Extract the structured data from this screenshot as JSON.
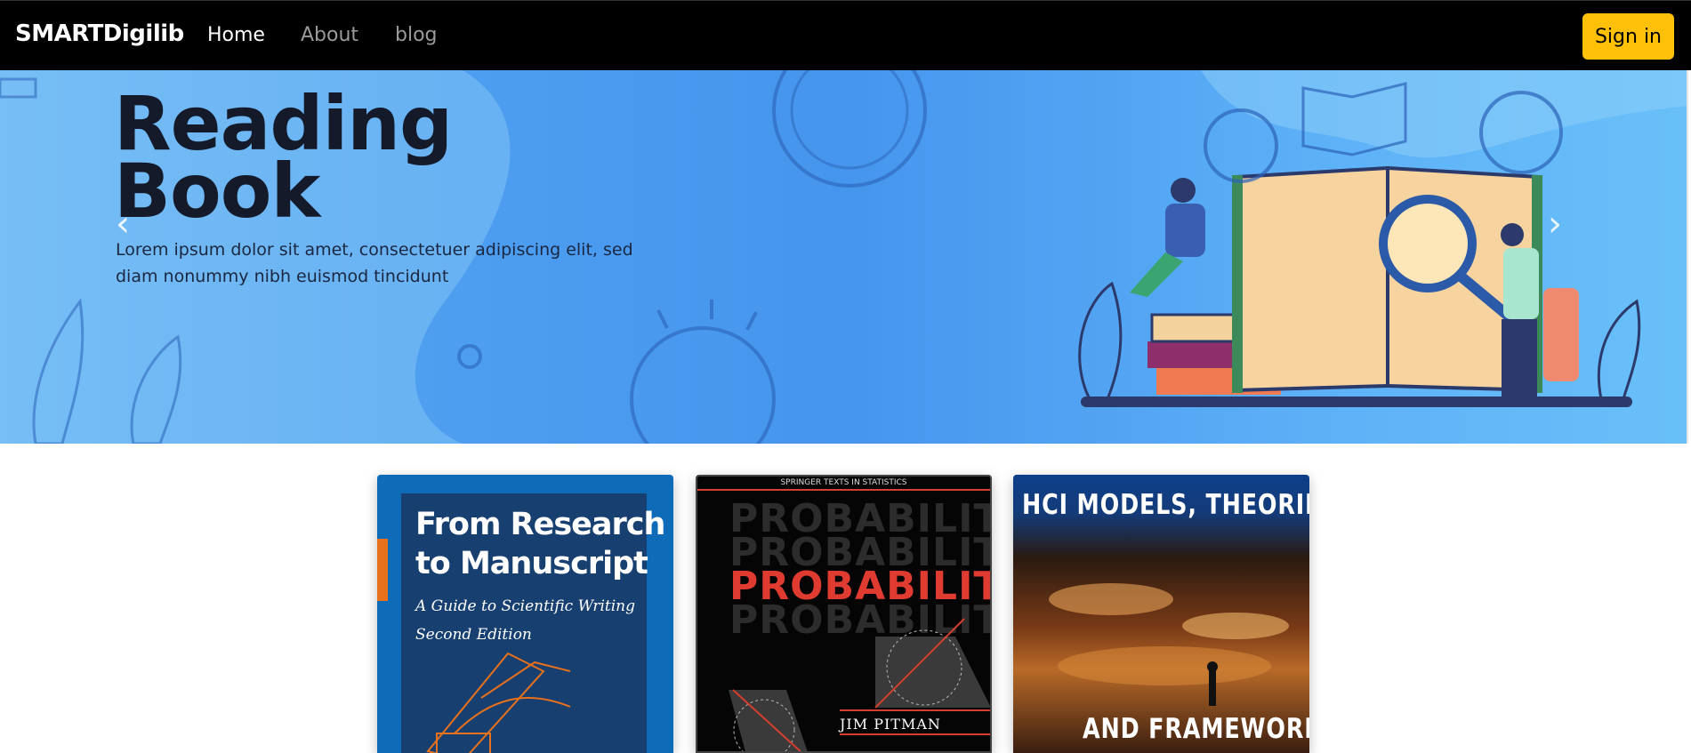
{
  "navbar": {
    "brand": "SMARTDigilib",
    "links": [
      {
        "label": "Home",
        "active": true
      },
      {
        "label": "About",
        "active": false
      },
      {
        "label": "blog",
        "active": false
      }
    ],
    "signin_label": "Sign in",
    "signin_color": "#ffc107"
  },
  "carousel": {
    "title_line1": "Reading",
    "title_line2": "Book",
    "subtitle_line1": "Lorem ipsum dolor sit amet, consectetuer adipiscing elit, sed",
    "subtitle_line2": "diam nonummy nibh euismod tincidunt",
    "prev_icon": "chevron-left-icon",
    "next_icon": "chevron-right-icon"
  },
  "books": [
    {
      "title_line1": "From Research",
      "title_line2": "to Manuscript",
      "subtitle_line1": "A Guide to Scientific Writing",
      "subtitle_line2": "Second Edition"
    },
    {
      "series": "SPRINGER TEXTS IN STATISTICS",
      "title": "PROBABILITY",
      "author": "JIM PITMAN"
    },
    {
      "title_top": "HCI MODELS, THEORIES",
      "title_bottom": "AND FRAMEWORKS"
    }
  ]
}
